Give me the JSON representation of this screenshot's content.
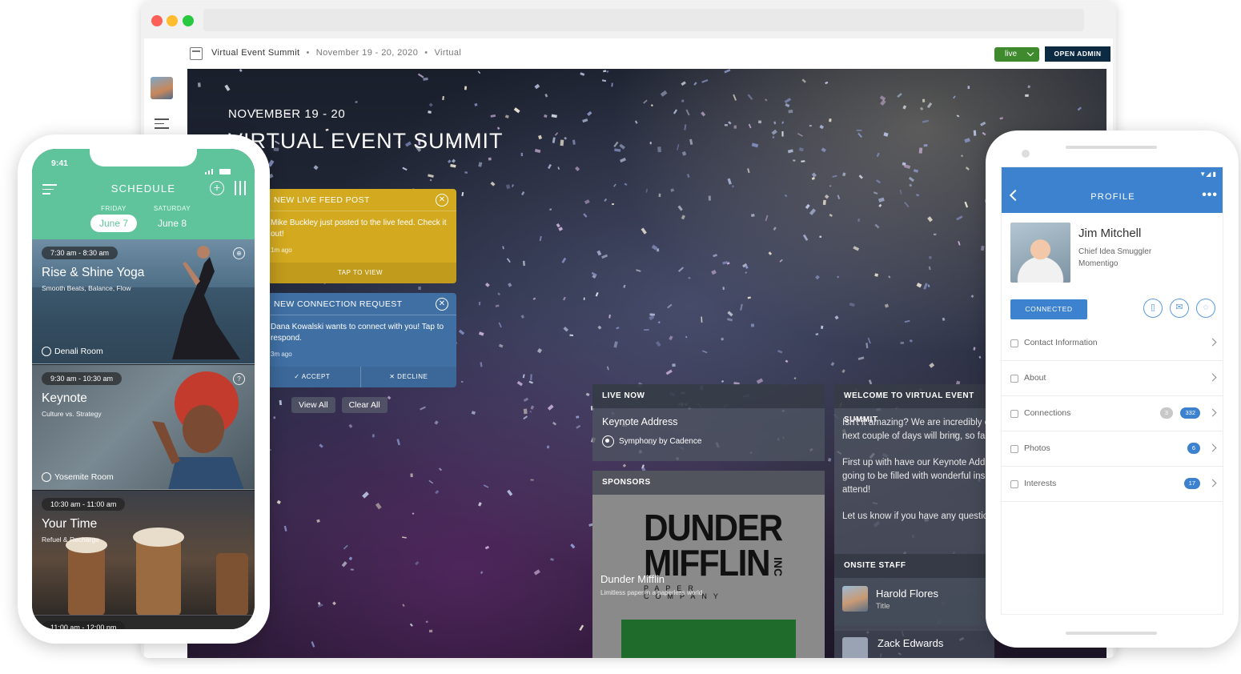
{
  "desktop": {
    "event_title": "Virtual Event Summit",
    "event_dates": "November 19 - 20, 2020",
    "event_mode": "Virtual",
    "separator": "•",
    "live_select": "live",
    "open_admin": "OPEN ADMIN",
    "hero_date": "NOVEMBER 19 - 20",
    "hero_title": "VIRTUAL EVENT SUMMIT",
    "notifications": [
      {
        "title": "NEW LIVE FEED POST",
        "body": "Mike Buckley just posted to the live feed. Check it out!",
        "ago": "1m ago",
        "action": "TAP TO VIEW",
        "color": "#d2a91f"
      },
      {
        "title": "NEW CONNECTION REQUEST",
        "body": "Dana Kowalski wants to connect with you! Tap to respond.",
        "ago": "3m ago",
        "accept": "ACCEPT",
        "decline": "DECLINE",
        "color": "#3f6fa3"
      }
    ],
    "view_all": "View All",
    "clear_all": "Clear All",
    "live_now": {
      "header": "LIVE NOW",
      "session": "Keynote Address",
      "location": "Symphony by Cadence"
    },
    "sponsors": {
      "header": "SPONSORS",
      "logo_line1": "DUNDER",
      "logo_line2": "MIFFLIN",
      "logo_inc": "INC",
      "logo_line3": "PAPER COMPANY",
      "name": "Dunder Mifflin",
      "tagline": "Limitless paper in a paperless world"
    },
    "welcome": {
      "header": "WELCOME TO VIRTUAL EVENT SUMMIT",
      "p1": "Isn't it amazing? We are incredibly excited for what the next couple of days will bring, so fasten your seatblets!",
      "p2": "First up with have our Keynote Address at Symphony. Its going to be filled with wonderful insights so make sure you attend!",
      "p3": "Let us know if you have any questions!"
    },
    "onsite_staff": {
      "header": "ONSITE STAFF",
      "staff": [
        {
          "name": "Harold Flores",
          "title": "Title"
        },
        {
          "name": "Zack Edwards"
        }
      ]
    }
  },
  "iphone": {
    "time": "9:41",
    "title": "SCHEDULE",
    "days": [
      {
        "weekday": "FRIDAY",
        "date": "June 7",
        "selected": true
      },
      {
        "weekday": "SATURDAY",
        "date": "June 8",
        "selected": false
      }
    ],
    "sessions": [
      {
        "time": "7:30 am - 8:30 am",
        "name": "Rise & Shine Yoga",
        "sub": "Smooth Beats, Balance, Flow",
        "room": "Denali Room"
      },
      {
        "time": "9:30 am - 10:30 am",
        "name": "Keynote",
        "sub": "Culture vs. Strategy",
        "room": "Yosemite Room"
      },
      {
        "time": "10:30 am - 11:00 am",
        "name": "Your Time",
        "sub": "Refuel & Recharge",
        "room": ""
      },
      {
        "time": "11:00 am - 12:00 pm"
      }
    ],
    "accent": "#5fc49c"
  },
  "android": {
    "title": "PROFILE",
    "name": "Jim Mitchell",
    "role": "Chief Idea Smuggler",
    "company": "Momentigo",
    "connected": "CONNECTED",
    "rows": [
      {
        "label": "Contact Information"
      },
      {
        "label": "About"
      },
      {
        "label": "Connections",
        "badge1": "3",
        "badge2": "332"
      },
      {
        "label": "Photos",
        "badge2": "6"
      },
      {
        "label": "Interests",
        "badge2": "17"
      }
    ],
    "accent": "#3d82cf"
  }
}
